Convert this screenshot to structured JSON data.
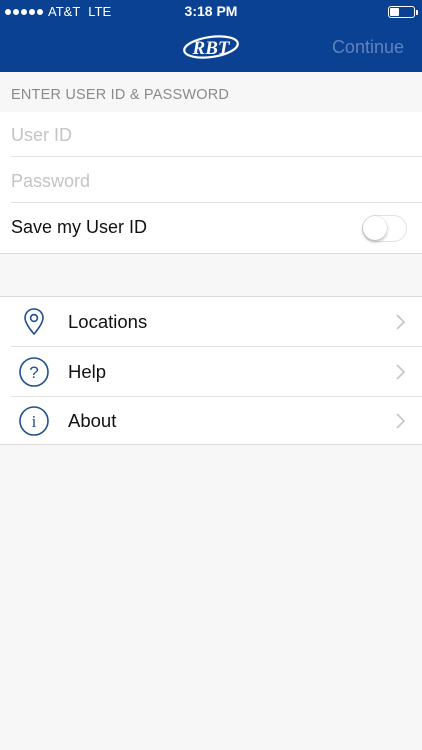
{
  "status_bar": {
    "carrier": "AT&T",
    "network": "LTE",
    "time": "3:18 PM",
    "battery_level": 0.4
  },
  "header": {
    "logo_text": "RBT",
    "continue_label": "Continue",
    "background_color": "#0b4192"
  },
  "login": {
    "section_title": "ENTER USER ID & PASSWORD",
    "user_id_placeholder": "User ID",
    "user_id_value": "",
    "password_placeholder": "Password",
    "password_value": "",
    "save_user_id_label": "Save my User ID",
    "save_user_id_enabled": false
  },
  "menu": {
    "items": [
      {
        "label": "Locations",
        "icon": "location-pin-icon"
      },
      {
        "label": "Help",
        "icon": "question-circle-icon"
      },
      {
        "label": "About",
        "icon": "info-circle-icon"
      }
    ]
  },
  "colors": {
    "brand_blue": "#0b4192",
    "icon_blue": "#1f4f8f",
    "continue_disabled": "#5f82bd"
  }
}
